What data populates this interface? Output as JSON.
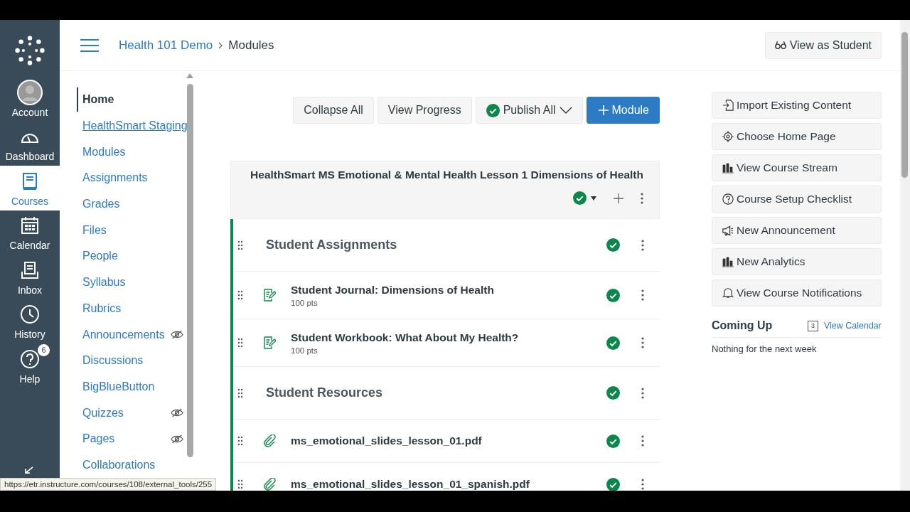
{
  "global_nav": [
    {
      "kind": "account",
      "label": "Account",
      "selected": false
    },
    {
      "kind": "dashboard",
      "label": "Dashboard",
      "selected": false
    },
    {
      "kind": "courses",
      "label": "Courses",
      "selected": true
    },
    {
      "kind": "calendar",
      "label": "Calendar",
      "selected": false
    },
    {
      "kind": "inbox",
      "label": "Inbox",
      "selected": false
    },
    {
      "kind": "history",
      "label": "History",
      "selected": false
    },
    {
      "kind": "help",
      "label": "Help",
      "selected": false,
      "badge": "6"
    }
  ],
  "breadcrumbs": [
    {
      "label": "Health 101 Demo",
      "link": true
    },
    {
      "label": "Modules",
      "link": false
    }
  ],
  "view_as_student": "View as Student",
  "course_nav": [
    {
      "label": "Home",
      "selected": true,
      "hovered": false,
      "hidden": false
    },
    {
      "label": "HealthSmart Staging",
      "selected": false,
      "hovered": true,
      "hidden": false
    },
    {
      "label": "Modules",
      "selected": false,
      "hovered": false,
      "hidden": false
    },
    {
      "label": "Assignments",
      "selected": false,
      "hovered": false,
      "hidden": false
    },
    {
      "label": "Grades",
      "selected": false,
      "hovered": false,
      "hidden": false
    },
    {
      "label": "Files",
      "selected": false,
      "hovered": false,
      "hidden": false
    },
    {
      "label": "People",
      "selected": false,
      "hovered": false,
      "hidden": false
    },
    {
      "label": "Syllabus",
      "selected": false,
      "hovered": false,
      "hidden": false
    },
    {
      "label": "Rubrics",
      "selected": false,
      "hovered": false,
      "hidden": false
    },
    {
      "label": "Announcements",
      "selected": false,
      "hovered": false,
      "hidden": true
    },
    {
      "label": "Discussions",
      "selected": false,
      "hovered": false,
      "hidden": false
    },
    {
      "label": "BigBlueButton",
      "selected": false,
      "hovered": false,
      "hidden": false
    },
    {
      "label": "Quizzes",
      "selected": false,
      "hovered": false,
      "hidden": true
    },
    {
      "label": "Pages",
      "selected": false,
      "hovered": false,
      "hidden": true
    },
    {
      "label": "Collaborations",
      "selected": false,
      "hovered": false,
      "hidden": false
    }
  ],
  "toolbar": [
    {
      "kind": "plain",
      "label": "Collapse All"
    },
    {
      "kind": "plain",
      "label": "View Progress"
    },
    {
      "kind": "publish",
      "label": "Publish All"
    },
    {
      "kind": "primary",
      "label": "Module"
    }
  ],
  "module": {
    "title": "HealthSmart MS Emotional & Mental Health Lesson 1 Dimensions of Health",
    "expanded": true,
    "published": true,
    "items": [
      {
        "kind": "subheader",
        "title": "Student Assignments",
        "published": true
      },
      {
        "kind": "assignment",
        "title": "Student Journal: Dimensions of Health",
        "points": "100 pts",
        "published": true
      },
      {
        "kind": "assignment",
        "title": "Student Workbook: What About My Health?",
        "points": "100 pts",
        "published": true
      },
      {
        "kind": "subheader",
        "title": "Student Resources",
        "published": true
      },
      {
        "kind": "file",
        "title": "ms_emotional_slides_lesson_01.pdf",
        "published": true
      },
      {
        "kind": "file",
        "title": "ms_emotional_slides_lesson_01_spanish.pdf",
        "published": true
      }
    ]
  },
  "sidebar_actions": [
    {
      "kind": "import",
      "label": "Import Existing Content"
    },
    {
      "kind": "home",
      "label": "Choose Home Page"
    },
    {
      "kind": "stream",
      "label": "View Course Stream"
    },
    {
      "kind": "checklist",
      "label": "Course Setup Checklist"
    },
    {
      "kind": "announcement",
      "label": "New Announcement"
    },
    {
      "kind": "analytics",
      "label": "New Analytics"
    },
    {
      "kind": "notifications",
      "label": "View Course Notifications"
    }
  ],
  "coming_up": {
    "title": "Coming Up",
    "calendar_day": "3",
    "link": "View Calendar",
    "empty": "Nothing for the next week"
  },
  "status_url": "https://etr.instructure.com/courses/108/external_tools/255"
}
